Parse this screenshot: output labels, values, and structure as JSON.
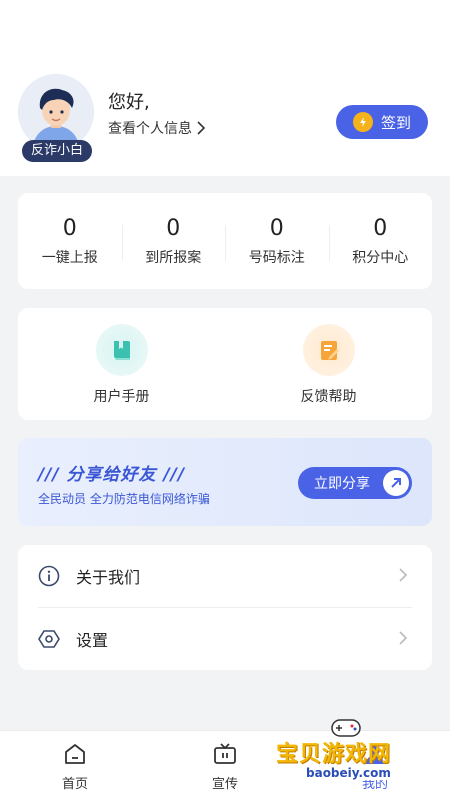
{
  "header": {
    "avatar_badge": "反诈小白",
    "greeting": "您好,",
    "profile_link": "查看个人信息",
    "signin_label": "签到",
    "colors": {
      "accent": "#4a63e6",
      "coin": "#f6b21a",
      "badge": "#2b3a67"
    }
  },
  "stats": [
    {
      "value": "0",
      "label": "一键上报"
    },
    {
      "value": "0",
      "label": "到所报案"
    },
    {
      "value": "0",
      "label": "号码标注"
    },
    {
      "value": "0",
      "label": "积分中心"
    }
  ],
  "tools": [
    {
      "label": "用户手册",
      "icon": "book-icon"
    },
    {
      "label": "反馈帮助",
      "icon": "edit-note-icon"
    }
  ],
  "share": {
    "title": "/// 分享给好友 ///",
    "subtitle": "全民动员 全力防范电信网络诈骗",
    "button_label": "立即分享"
  },
  "menu": [
    {
      "label": "关于我们",
      "icon": "info-icon"
    },
    {
      "label": "设置",
      "icon": "settings-icon"
    }
  ],
  "tabbar": [
    {
      "label": "首页",
      "icon": "home-icon"
    },
    {
      "label": "宣传",
      "icon": "tv-icon"
    },
    {
      "label": "我的",
      "icon": "profile-icon"
    }
  ],
  "watermark": {
    "text": "宝贝游戏网",
    "url": "baobeiy.com"
  }
}
